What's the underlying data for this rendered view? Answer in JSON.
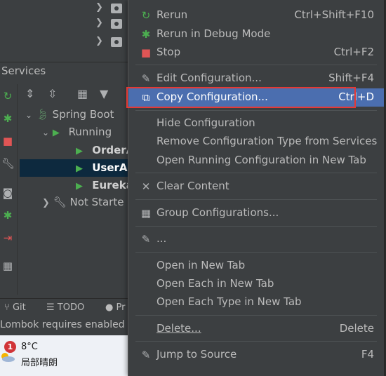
{
  "services_panel": {
    "title": "Services",
    "tree": {
      "spring_boot": "Spring Boot",
      "running": "Running",
      "apps": [
        "OrderA",
        "UserAp",
        "Eureka"
      ],
      "not_started": "Not Starte"
    }
  },
  "bottom_tabs": {
    "git": "Git",
    "todo": "TODO",
    "problems": "Pr"
  },
  "status": {
    "message": "Lombok requires enabled"
  },
  "taskbar": {
    "weather_badge": "1",
    "temperature": "8°C",
    "condition": "局部晴朗"
  },
  "context_menu": {
    "items": [
      {
        "label": "Rerun",
        "shortcut": "Ctrl+Shift+F10",
        "icon": "rerun-icon"
      },
      {
        "label": "Rerun in Debug Mode",
        "shortcut": "",
        "icon": "debug-icon"
      },
      {
        "label": "Stop",
        "shortcut": "Ctrl+F2",
        "icon": "stop-icon"
      },
      {
        "label": "Edit Configuration...",
        "shortcut": "Shift+F4",
        "icon": "edit-icon"
      },
      {
        "label": "Copy Configuration...",
        "shortcut": "Ctrl+D",
        "icon": "copy-icon"
      },
      {
        "label": "Hide Configuration",
        "shortcut": ""
      },
      {
        "label": "Remove Configuration Type from Services",
        "shortcut": ""
      },
      {
        "label": "Open Running Configuration in New Tab",
        "shortcut": ""
      },
      {
        "label": "Clear Content",
        "shortcut": "",
        "icon": "close-icon"
      },
      {
        "label": "Group Configurations...",
        "shortcut": "",
        "icon": "group-icon"
      },
      {
        "label": "...",
        "shortcut": "",
        "icon": "pencil-icon"
      },
      {
        "label": "Open in New Tab",
        "shortcut": ""
      },
      {
        "label": "Open Each in New Tab",
        "shortcut": ""
      },
      {
        "label": "Open Each Type in New Tab",
        "shortcut": ""
      },
      {
        "label": "Delete...",
        "shortcut": "Delete"
      },
      {
        "label": "Jump to Source",
        "shortcut": "F4",
        "icon": "jump-icon"
      }
    ],
    "highlighted_index": 4
  },
  "colors": {
    "menu_bg": "#3c3f41",
    "highlight": "#4b6eaf",
    "annotation_box": "#e53935",
    "run_green": "#4caf50",
    "stop_red": "#e05555"
  }
}
